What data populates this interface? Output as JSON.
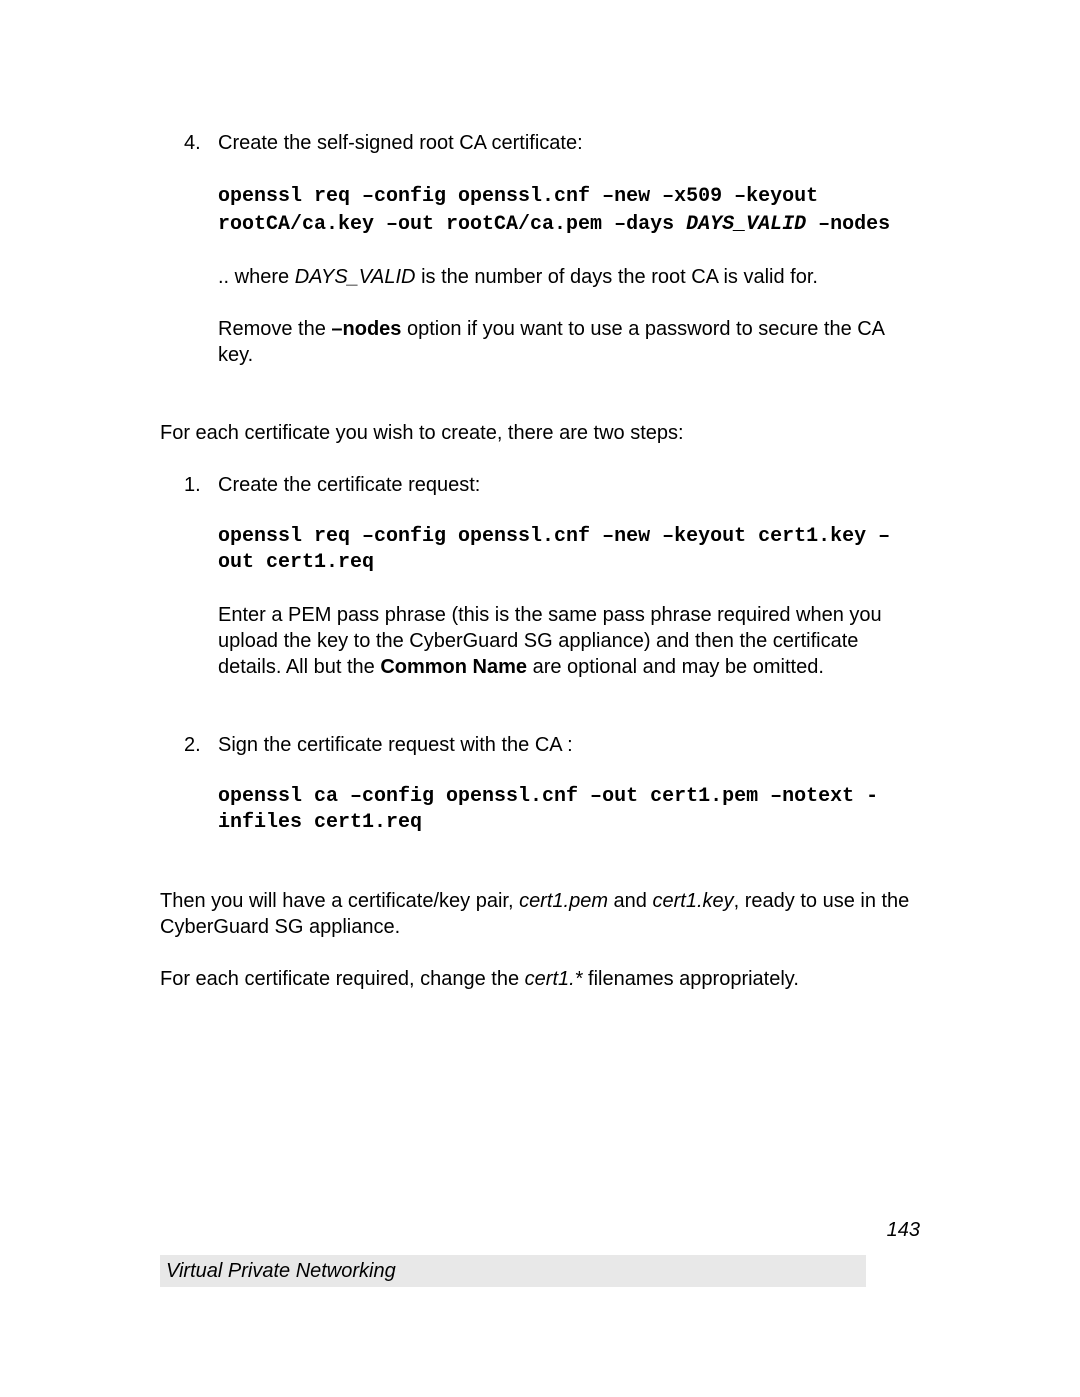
{
  "step4": {
    "num": "4.",
    "title": "Create the self-signed root CA certificate:",
    "cmd_a": "openssl req –config openssl.cnf –new –x509 –keyout rootCA/ca.key –out rootCA/ca.pem –days ",
    "cmd_days_var": "DAYS_VALID",
    "cmd_b": " –nodes",
    "where_a": ".. where ",
    "where_var": "DAYS_VALID",
    "where_b": " is the number of days the root CA is valid for.",
    "remove_a": "Remove the ",
    "remove_bold": "–nodes",
    "remove_b": " option if you want to use a password to secure the CA key."
  },
  "intro2": "For each certificate you wish to create, there are two steps:",
  "sstep1": {
    "num": "1.",
    "title": "Create the certificate request:",
    "cmd": "openssl req –config openssl.cnf –new –keyout cert1.key –out cert1.req",
    "note_a": "Enter a PEM pass phrase (this is the same pass phrase required when you upload the key to the CyberGuard SG appliance) and then the certificate details. All but the ",
    "note_bold": "Common Name",
    "note_b": " are optional and may be omitted."
  },
  "sstep2": {
    "num": "2.",
    "title": "Sign the certificate request with the CA :",
    "cmd": "openssl ca –config openssl.cnf –out cert1.pem –notext -infiles cert1.req"
  },
  "tail1_a": "Then you will have a certificate/key pair, ",
  "tail1_i1": "cert1.pem",
  "tail1_b": " and ",
  "tail1_i2": "cert1.key",
  "tail1_c": ", ready to use in the CyberGuard SG appliance.",
  "tail2_a": "For each certificate required, change the ",
  "tail2_i": "cert1.*",
  "tail2_b": " filenames appropriately.",
  "footer": {
    "page": "143",
    "title": "Virtual Private Networking"
  }
}
